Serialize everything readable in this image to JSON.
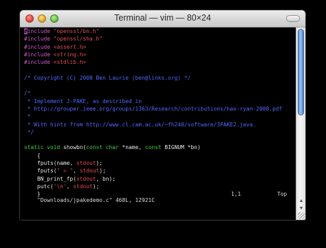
{
  "window": {
    "title": "Terminal — vim — 80×24"
  },
  "terminal": {
    "lines": [
      [
        {
          "t": "#",
          "c": "cursor"
        },
        {
          "t": "include ",
          "c": "pp"
        },
        {
          "t": "\"openssl/bn.h\"",
          "c": "str"
        }
      ],
      [
        {
          "t": "#include ",
          "c": "pp"
        },
        {
          "t": "\"openssl/sha.h\"",
          "c": "str"
        }
      ],
      [
        {
          "t": "#include ",
          "c": "pp"
        },
        {
          "t": "<assert.h>",
          "c": "str"
        }
      ],
      [
        {
          "t": "#include ",
          "c": "pp"
        },
        {
          "t": "<string.h>",
          "c": "str"
        }
      ],
      [
        {
          "t": "#include ",
          "c": "pp"
        },
        {
          "t": "<stdlib.h>",
          "c": "str"
        }
      ],
      [],
      [
        {
          "t": "/* Copyright (C) 2008 Ben Laurie (ben@links.org) */",
          "c": "cm"
        }
      ],
      [],
      [
        {
          "t": "/*",
          "c": "cm"
        }
      ],
      [
        {
          "t": " * Implement J-PAKE, as described in",
          "c": "cm"
        }
      ],
      [
        {
          "t": " * http://grouper.ieee.org/groups/1363/Research/contributions/hao-ryan-2008.pdf",
          "c": "cm"
        }
      ],
      [
        {
          "t": " *",
          "c": "cm"
        }
      ],
      [
        {
          "t": " * With hints from http://www.cl.cam.ac.uk/~fh240/software/JPAKE2.java.",
          "c": "cm"
        }
      ],
      [
        {
          "t": " */",
          "c": "cm"
        }
      ],
      [],
      [
        {
          "t": "static void",
          "c": "kw"
        },
        {
          "t": " showbn(",
          "c": "wh"
        },
        {
          "t": "const char",
          "c": "kw"
        },
        {
          "t": " *name, ",
          "c": "wh"
        },
        {
          "t": "const",
          "c": "kw"
        },
        {
          "t": " BIGNUM *bn)",
          "c": "wh"
        }
      ],
      [
        {
          "t": "    {",
          "c": "wh"
        }
      ],
      [
        {
          "t": "    fputs(name, ",
          "c": "wh"
        },
        {
          "t": "stdout",
          "c": "sd"
        },
        {
          "t": ");",
          "c": "wh"
        }
      ],
      [
        {
          "t": "    fputs(",
          "c": "wh"
        },
        {
          "t": "\" = \"",
          "c": "str"
        },
        {
          "t": ", ",
          "c": "wh"
        },
        {
          "t": "stdout",
          "c": "sd"
        },
        {
          "t": ");",
          "c": "wh"
        }
      ],
      [
        {
          "t": "    BN_print_fp(",
          "c": "wh"
        },
        {
          "t": "stdout",
          "c": "sd"
        },
        {
          "t": ", bn);",
          "c": "wh"
        }
      ],
      [
        {
          "t": "    putc(",
          "c": "wh"
        },
        {
          "t": "'\\n'",
          "c": "str"
        },
        {
          "t": ", ",
          "c": "wh"
        },
        {
          "t": "stdout",
          "c": "sd"
        },
        {
          "t": ");",
          "c": "wh"
        }
      ],
      [
        {
          "t": "    }",
          "c": "wh"
        }
      ]
    ],
    "status": {
      "file": "\"Downloads/jpakedemo.c\" 468L, 12921C",
      "position": "1,1",
      "scroll": "Top"
    }
  },
  "scrollbar": {
    "position_fraction": 0.0,
    "visible_fraction": 0.05
  }
}
